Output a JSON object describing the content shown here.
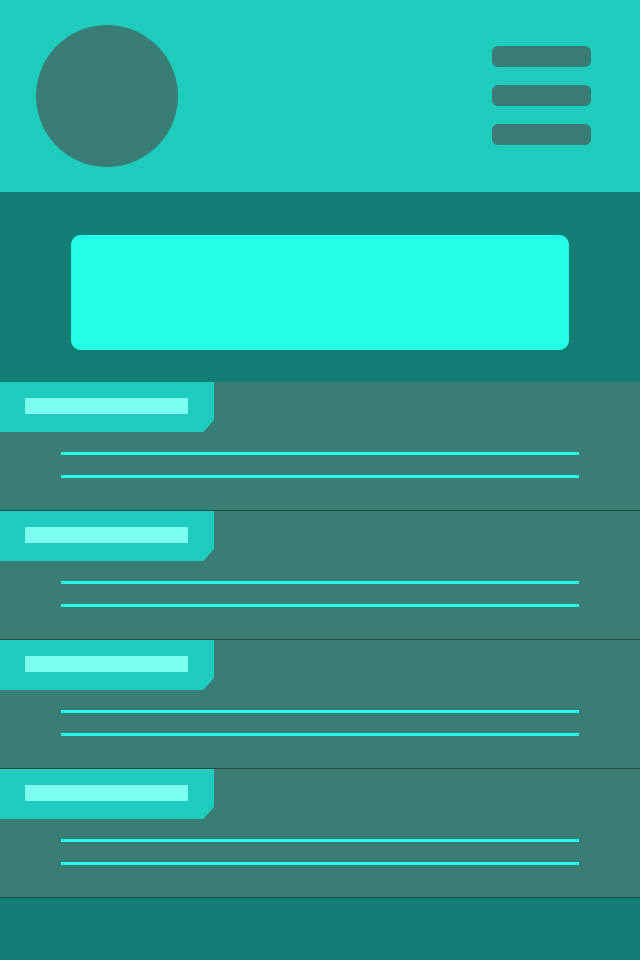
{
  "header": {
    "avatar": "avatar",
    "menu_icon": "hamburger-menu-icon"
  },
  "banner": {
    "label": ""
  },
  "list": {
    "items": [
      {
        "title": "",
        "lines": [
          "",
          ""
        ]
      },
      {
        "title": "",
        "lines": [
          "",
          ""
        ]
      },
      {
        "title": "",
        "lines": [
          "",
          ""
        ]
      },
      {
        "title": "",
        "lines": [
          "",
          ""
        ]
      }
    ]
  },
  "colors": {
    "header_bg": "#1fcbbc",
    "avatar": "#3a7d75",
    "section_bg": "#117d75",
    "banner_card": "#24ffe9",
    "list_item_bg": "#3a7d75",
    "tab_bg": "#1fcbbc",
    "tab_bar": "#7dfff0",
    "line": "#24ffe9"
  }
}
